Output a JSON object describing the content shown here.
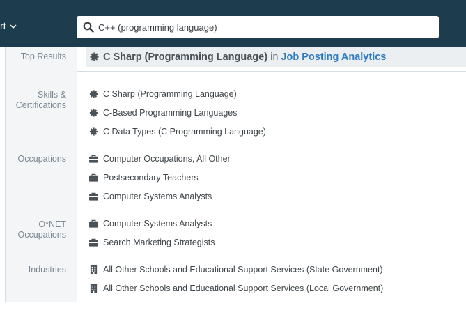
{
  "header": {
    "menu_fragment": "rt",
    "search": {
      "value": "C++ (programming language)",
      "icon": "search-icon"
    }
  },
  "results": {
    "top": {
      "label": "Top Results",
      "name": "C Sharp (Programming Language)",
      "connector": "in",
      "dataset": "Job Posting Analytics",
      "icon": "gear-icon"
    },
    "skills": {
      "label_line1": "Skills &",
      "label_line2": "Certifications",
      "items": [
        "C Sharp (Programming Language)",
        "C-Based Programming Languages",
        "C Data Types (C Programming Language)"
      ]
    },
    "occupations": {
      "label": "Occupations",
      "items": [
        "Computer Occupations, All Other",
        "Postsecondary Teachers",
        "Computer Systems Analysts"
      ]
    },
    "onet": {
      "label_line1": "O*NET",
      "label_line2": "Occupations",
      "items": [
        "Computer Systems Analysts",
        "Search Marketing Strategists"
      ]
    },
    "industries": {
      "label": "Industries",
      "items": [
        "All Other Schools and Educational Support Services (State Government)",
        "All Other Schools and Educational Support Services (Local Government)"
      ]
    }
  },
  "colors": {
    "header_bg": "#1d3d4e",
    "rail_bg": "#f3f5f7",
    "link": "#2f7ac0"
  }
}
